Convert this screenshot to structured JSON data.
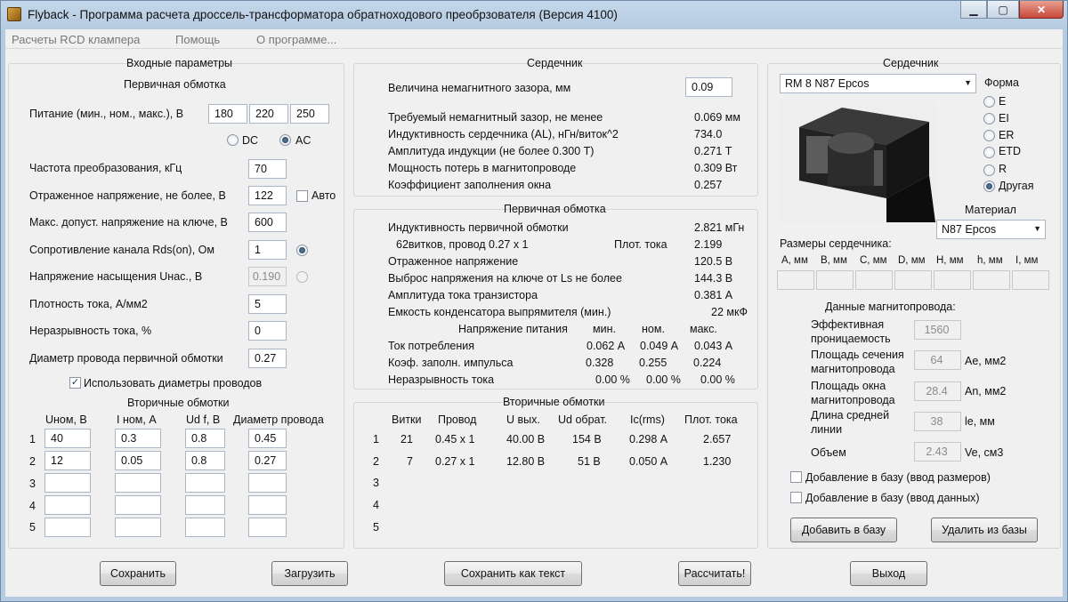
{
  "window": {
    "title": "Flyback - Программа расчета дроссель-трансформатора обратноходового преобрзователя (Версия 4100)"
  },
  "menu": [
    "Расчеты RCD клампера",
    "Помощь",
    "О программе..."
  ],
  "input": {
    "title": "Входные параметры",
    "primary_title": "Первичная обмотка",
    "supply_label": "Питание (мин., ном., макс.), В",
    "supply_min": "180",
    "supply_nom": "220",
    "supply_max": "250",
    "dc_label": "DC",
    "ac_label": "AC",
    "rows": [
      {
        "label": "Частота преобразования, кГц",
        "value": "70"
      },
      {
        "label": "Отраженное напряжение, не более, В",
        "value": "122"
      },
      {
        "label": "Макс. допуст. напряжение на ключе, В",
        "value": "600"
      },
      {
        "label": "Сопротивление канала Rds(on), Ом",
        "value": "1"
      },
      {
        "label": "Напряжение насыщения Uнас., В",
        "value": "0.190"
      },
      {
        "label": "Плотность тока, А/мм2",
        "value": "5"
      },
      {
        "label": "Неразрывность тока, %",
        "value": "0"
      },
      {
        "label": "Диаметр провода первичной обмотки",
        "value": "0.27"
      }
    ],
    "auto_label": "Авто",
    "use_diam_label": "Использовать диаметры проводов",
    "secondary_title": "Вторичные обмотки",
    "sec_headers": [
      "Uном, В",
      "I ном, А",
      "Ud f, В",
      "Диаметр провода"
    ],
    "sec_rows": [
      {
        "n": "1",
        "u": "40",
        "i": "0.3",
        "ud": "0.8",
        "d": "0.45"
      },
      {
        "n": "2",
        "u": "12",
        "i": "0.05",
        "ud": "0.8",
        "d": "0.27"
      },
      {
        "n": "3",
        "u": "",
        "i": "",
        "ud": "",
        "d": ""
      },
      {
        "n": "4",
        "u": "",
        "i": "",
        "ud": "",
        "d": ""
      },
      {
        "n": "5",
        "u": "",
        "i": "",
        "ud": "",
        "d": ""
      }
    ]
  },
  "core_calc": {
    "title": "Сердечник",
    "gap_label": "Величина немагнитного зазора, мм",
    "gap_value": "0.09",
    "rows": [
      {
        "label": "Требуемый немагнитный зазор, не менее",
        "value": "0.069 мм"
      },
      {
        "label": "Индуктивность сердечника (AL), нГн/виток^2",
        "value": "734.0"
      },
      {
        "label": "Амплитуда индукции     (не более 0.300 Т)",
        "value": "0.271 Т"
      },
      {
        "label": "Мощность потерь в магнитопроводе",
        "value": "0.309 Вт"
      },
      {
        "label": "Коэффициент заполнения окна",
        "value": "0.257"
      }
    ]
  },
  "primary": {
    "title": "Первичная обмотка",
    "inductance_label": "Индуктивность первичной обмотки",
    "inductance_value": "2.821 мГн",
    "turns_label": "62витков,  провод 0.27 х 1",
    "density_label": "Плот. тока",
    "density_value": "2.199",
    "rows": [
      {
        "label": "Отраженное напряжение",
        "value": "120.5 В"
      },
      {
        "label": "Выброс напряжения на ключе от Ls не более",
        "value": "144.3 В"
      },
      {
        "label": "Амплитуда тока транзистора",
        "value": "0.381 А"
      },
      {
        "label": "Емкость конденсатора выпрямителя (мин.)",
        "value": "22 мкФ"
      }
    ],
    "supply_header": "Напряжение питания",
    "col_headers": [
      "мин.",
      "ном.",
      "макс."
    ],
    "table": [
      {
        "label": "Ток потребления",
        "v": [
          "0.062 А",
          "0.049 А",
          "0.043 А"
        ]
      },
      {
        "label": "Коэф. заполн. импульса",
        "v": [
          "0.328",
          "0.255",
          "0.224"
        ]
      },
      {
        "label": "Неразрывность тока",
        "v": [
          "0.00 %",
          "0.00 %",
          "0.00 %"
        ]
      }
    ]
  },
  "secondary": {
    "title": "Вторичные обмотки",
    "headers": [
      "Витки",
      "Провод",
      "U вых.",
      "Ud обрат.",
      "Ic(rms)",
      "Плот. тока"
    ],
    "rows": [
      {
        "n": "1",
        "v": [
          "21",
          "0.45 х 1",
          "40.00 В",
          "154 В",
          "0.298 А",
          "2.657"
        ]
      },
      {
        "n": "2",
        "v": [
          "7",
          "0.27 х 1",
          "12.80 В",
          "51 В",
          "0.050 А",
          "1.230"
        ]
      },
      {
        "n": "3",
        "v": [
          "",
          "",
          "",
          "",
          "",
          ""
        ]
      },
      {
        "n": "4",
        "v": [
          "",
          "",
          "",
          "",
          "",
          ""
        ]
      },
      {
        "n": "5",
        "v": [
          "",
          "",
          "",
          "",
          "",
          ""
        ]
      }
    ]
  },
  "core_sel": {
    "title": "Сердечник",
    "core_combo": "RM 8 N87 Epcos",
    "shape_title": "Форма",
    "shapes": [
      "E",
      "EI",
      "ER",
      "ETD",
      "R",
      "Другая"
    ],
    "material_title": "Материал",
    "material_combo": "N87 Epcos",
    "dims_title": "Размеры сердечника:",
    "dims": [
      "A, мм",
      "B, мм",
      "C, мм",
      "D, мм",
      "H, мм",
      "h, мм",
      "I, мм"
    ],
    "mag_title": "Данные магнитопровода:",
    "mag": [
      {
        "label1": "Эффективная",
        "label2": "проницаемость",
        "value": "1560",
        "unit": ""
      },
      {
        "label1": "Площадь сечения",
        "label2": "магнитопровода",
        "value": "64",
        "unit": "Ae, мм2"
      },
      {
        "label1": "Площадь окна",
        "label2": "магнитопровода",
        "value": "28.4",
        "unit": "An, мм2"
      },
      {
        "label1": "Длина средней",
        "label2": "линии",
        "value": "38",
        "unit": "le, мм"
      },
      {
        "label1": "Объем",
        "label2": "",
        "value": "2.43",
        "unit": "Ve, см3"
      }
    ],
    "add_dims": "Добавление в базу (ввод размеров)",
    "add_data": "Добавление в базу (ввод данных)",
    "add_btn": "Добавить в базу",
    "del_btn": "Удалить из базы"
  },
  "buttons": {
    "save": "Сохранить",
    "load": "Загрузить",
    "save_text": "Сохранить как текст",
    "calc": "Рассчитать!",
    "exit": "Выход"
  }
}
